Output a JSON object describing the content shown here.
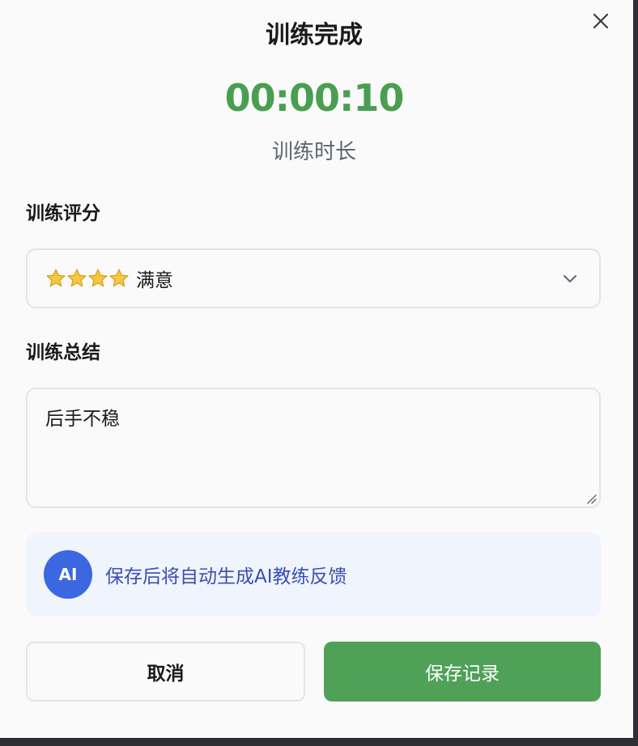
{
  "dialog": {
    "title": "训练完成",
    "duration": "00:00:10",
    "duration_label": "训练时长"
  },
  "rating": {
    "label": "训练评分",
    "selected_value": "满意",
    "stars": 4
  },
  "summary": {
    "label": "训练总结",
    "value": "后手不稳"
  },
  "ai_notice": {
    "badge": "AI",
    "text": "保存后将自动生成AI教练反馈"
  },
  "actions": {
    "cancel_label": "取消",
    "save_label": "保存记录"
  },
  "colors": {
    "timer": "#4a9e52",
    "save_button": "#4fa157",
    "ai_badge": "#3b68e0",
    "ai_text": "#3a4fb0"
  },
  "icons": {
    "close": "close-icon",
    "dropdown": "chevron-down-icon",
    "star": "star-icon",
    "resize": "resize-handle-icon"
  }
}
